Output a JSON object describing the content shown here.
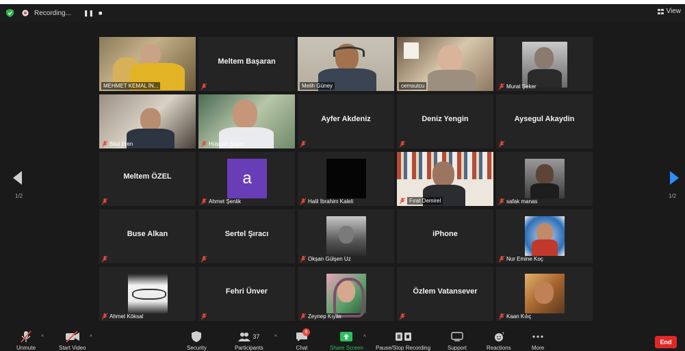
{
  "topbar": {
    "recording_label": "Recording...",
    "view_label": "View",
    "shield_color": "#2bb24c"
  },
  "gallery": {
    "page_indicator_left": "1/2",
    "page_indicator_right": "1/2",
    "active_speaker_color": "#b7d04e"
  },
  "participants": [
    {
      "name": "MEHMET KEMAL İN...",
      "type": "video",
      "muted": false
    },
    {
      "name": "Meltem Başaran",
      "type": "name",
      "muted": true
    },
    {
      "name": "Melih Güney",
      "type": "video",
      "muted": false,
      "active": true
    },
    {
      "name": "cemsutcu",
      "type": "video",
      "muted": false
    },
    {
      "name": "Murat Şeker",
      "type": "photo",
      "muted": true
    },
    {
      "name": "Bilal Eren",
      "type": "video",
      "muted": true
    },
    {
      "name": "Hüseyin Şayın",
      "type": "video",
      "muted": true
    },
    {
      "name": "Ayfer Akdeniz",
      "type": "name",
      "muted": true
    },
    {
      "name": "Deniz Yengin",
      "type": "name",
      "muted": true
    },
    {
      "name": "Aysegul Akaydin",
      "type": "name",
      "muted": true
    },
    {
      "name": "Meltem ÖZEL",
      "type": "name",
      "muted": true
    },
    {
      "name": "Ahmet Şenlik",
      "type": "letter",
      "letter": "a",
      "muted": true
    },
    {
      "name": "Halil İbrahim Kaleli",
      "type": "photo",
      "muted": true
    },
    {
      "name": "Fırat Demirel",
      "type": "video",
      "muted": true
    },
    {
      "name": "safak manas",
      "type": "photo",
      "muted": true
    },
    {
      "name": "Buse Alkan",
      "type": "name",
      "muted": true
    },
    {
      "name": "Sertel Şıracı",
      "type": "name",
      "muted": true
    },
    {
      "name": "Okşan Gülşen Uz",
      "type": "photo",
      "muted": true
    },
    {
      "name": "iPhone",
      "type": "name",
      "muted": false
    },
    {
      "name": "Nur Emine Koç",
      "type": "photo",
      "muted": true
    },
    {
      "name": "Ahmet Köksal",
      "type": "photo",
      "muted": true
    },
    {
      "name": "Fehri Ünver",
      "type": "name",
      "muted": true
    },
    {
      "name": "Zeynep Kıyas",
      "type": "photo",
      "muted": true
    },
    {
      "name": "Özlem Vatansever",
      "type": "name",
      "muted": true
    },
    {
      "name": "Kaan Kılıç",
      "type": "photo",
      "muted": true
    }
  ],
  "toolbar": {
    "unmute": "Unmute",
    "start_video": "Start Video",
    "security": "Security",
    "participants": "Participants",
    "participants_count": "37",
    "chat": "Chat",
    "chat_badge": "6",
    "share_screen": "Share Screen",
    "pause_stop_recording": "Pause/Stop Recording",
    "support": "Support",
    "reactions": "Reactions",
    "more": "More",
    "end": "End",
    "share_color": "#2bbf5f",
    "end_color": "#e12828"
  }
}
